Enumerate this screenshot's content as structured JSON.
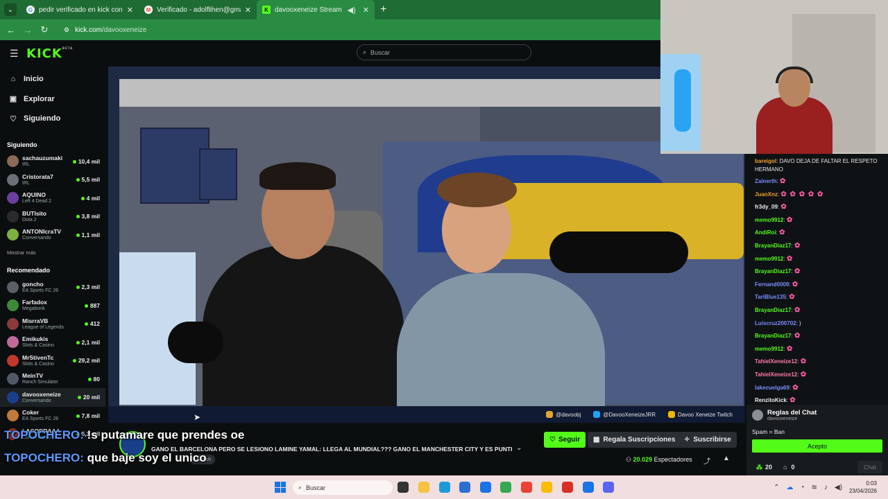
{
  "browser": {
    "tabs": [
      {
        "title": "pedir verificado en kick con you",
        "active": false
      },
      {
        "title": "Verificado - adolflihen@gmail.c",
        "active": false
      },
      {
        "title": "davooxeneize Stream - Wat",
        "active": true
      }
    ],
    "url_host": "kick.com",
    "url_path": "/davooxeneize",
    "colors": {
      "frame": "#1f6b34",
      "active_tab": "#2a8c43"
    }
  },
  "kick": {
    "logo": "KICK",
    "logo_badge": "BETA",
    "search_placeholder": "Buscar",
    "nav": [
      {
        "label": "Inicio",
        "icon": "home-icon",
        "glyph": "⌂"
      },
      {
        "label": "Explorar",
        "icon": "compass-icon",
        "glyph": "▣"
      },
      {
        "label": "Siguiendo",
        "icon": "heart-icon",
        "glyph": "♡"
      }
    ],
    "following_heading": "Siguiendo",
    "following": [
      {
        "name": "sachauzumaki",
        "category": "IRL",
        "viewers": "10,4 mil",
        "color": "#8a6a58"
      },
      {
        "name": "Cristorata7",
        "category": "IRL",
        "viewers": "5,5 mil",
        "color": "#6d6f78"
      },
      {
        "name": "AQUINO",
        "category": "Left 4 Dead 2",
        "viewers": "4 mil",
        "color": "#6b3fa0"
      },
      {
        "name": "BUTIsito",
        "category": "Dota 2",
        "viewers": "3,8 mil",
        "color": "#2b2b2b"
      },
      {
        "name": "ANTONIcraTV",
        "category": "Conversando",
        "viewers": "1,1 mil",
        "color": "#7fb043"
      }
    ],
    "show_more": "Mostrar más",
    "recommended_heading": "Recomendado",
    "recommended": [
      {
        "name": "goncho",
        "category": "EA Sports FC 26",
        "viewers": "2,3 mil",
        "color": "#5a5f68"
      },
      {
        "name": "Farfadox",
        "category": "Megabonk",
        "viewers": "887",
        "color": "#3e8a3a"
      },
      {
        "name": "MisrraVB",
        "category": "League of Legends",
        "viewers": "412",
        "color": "#8a3a3a"
      },
      {
        "name": "Emikukis",
        "category": "Slots & Casino",
        "viewers": "2,1 mil",
        "color": "#c06a9a"
      },
      {
        "name": "MrStivenTc",
        "category": "Slots & Casino",
        "viewers": "29,2 mil",
        "color": "#c0392b"
      },
      {
        "name": "MeinTV",
        "category": "Ranch Simulator",
        "viewers": "80",
        "color": "#4f5a66"
      },
      {
        "name": "davooxeneize",
        "category": "Conversando",
        "viewers": "20 mil",
        "color": "#1a3f8a",
        "active": true
      },
      {
        "name": "Coker",
        "category": "EA Sports FC 26",
        "viewers": "7,8 mil",
        "color": "#c07a3a"
      },
      {
        "name": "LACOBRAAA",
        "category": "Conversando",
        "viewers": "5,3 mil",
        "color": "#9a3030"
      }
    ],
    "accent": "#53fc18"
  },
  "video": {
    "overlay_socials": [
      {
        "icon": "instagram-icon",
        "text": "@davoobj",
        "color": "#e1a530"
      },
      {
        "icon": "twitter-icon",
        "text": "@DavooXeneizeJRR",
        "color": "#1da1f2"
      },
      {
        "icon": "youtube-icon",
        "text": "Davoo Xeneize Twitch",
        "color": "#f2b705"
      }
    ]
  },
  "stream_info": {
    "title": "GANO EL BARCELONA PERO SE LESIONO LAMINE YAMAL: LLEGA AL MUNDIAL??? GANO EL MANCHESTER CITY Y ES PUNTE...",
    "tag": "spanish",
    "follow_label": "Seguir",
    "gift_label": "Regala Suscripciones",
    "subscribe_label": "Suscribirse",
    "viewers_count": "20.029",
    "viewers_label": "Espectadores"
  },
  "captions": [
    {
      "user": "TOPOCHERO:",
      "text": " !s putamare que prendes oe"
    },
    {
      "user": "TOPOCHERO:",
      "text": " que baje soy el unico"
    }
  ],
  "chat": {
    "messages": [
      {
        "user": "bareigol",
        "color": "#f0a030",
        "text": ": DAVO DEJA DE FALTAR EL RESPETO HERMANO",
        "emotes": ""
      },
      {
        "user": "Zainerth",
        "color": "#7a8cff",
        "text": ":",
        "emotes": "✿"
      },
      {
        "user": "JuanXnz",
        "color": "#f0a030",
        "text": ":",
        "emotes": "✿ ✿ ✿ ✿ ✿"
      },
      {
        "user": "fr3dy_09",
        "color": "#eeeeee",
        "text": ":",
        "emotes": "✿"
      },
      {
        "user": "memo9912",
        "color": "#53fc18",
        "text": ":",
        "emotes": "✿"
      },
      {
        "user": "AndiRoi",
        "color": "#53fc18",
        "text": ":",
        "emotes": "✿"
      },
      {
        "user": "BrayanDiaz17",
        "color": "#53fc18",
        "text": ":",
        "emotes": "✿"
      },
      {
        "user": "memo9912",
        "color": "#53fc18",
        "text": ":",
        "emotes": "✿"
      },
      {
        "user": "BrayanDiaz17",
        "color": "#53fc18",
        "text": ":",
        "emotes": "✿"
      },
      {
        "user": "Fernand0009",
        "color": "#7a8cff",
        "text": ":",
        "emotes": "✿"
      },
      {
        "user": "TariBlue135",
        "color": "#7a8cff",
        "text": ":",
        "emotes": "✿"
      },
      {
        "user": "BrayanDiaz17",
        "color": "#53fc18",
        "text": ":",
        "emotes": "✿"
      },
      {
        "user": "Luiscruz200702",
        "color": "#7a8cff",
        "text": ": )",
        "emotes": ""
      },
      {
        "user": "BrayanDiaz17",
        "color": "#53fc18",
        "text": ":",
        "emotes": "✿"
      },
      {
        "user": "memo9912",
        "color": "#53fc18",
        "text": ":",
        "emotes": "✿"
      },
      {
        "user": "TahielXeneize12",
        "color": "#ff7aa8",
        "text": ":",
        "emotes": "✿"
      },
      {
        "user": "TahielXeneize12",
        "color": "#ff7aa8",
        "text": ":",
        "emotes": "✿"
      },
      {
        "user": "lakecuelga69",
        "color": "#7a8cff",
        "text": ":",
        "emotes": "✿"
      },
      {
        "user": "RenzitoKick",
        "color": "#eeeeee",
        "text": ":",
        "emotes": "✿"
      }
    ],
    "rules_title": "Reglas del Chat",
    "rules_channel": "davooxeneize",
    "rules_text": "Spam = Ban",
    "accept_label": "Acepto",
    "points": "20",
    "gifts": "0",
    "chat_button": "Chat"
  },
  "taskbar": {
    "search_placeholder": "Buscar",
    "time": "0:03",
    "date": "23/04/2026",
    "apps": [
      {
        "icon": "task-view-icon",
        "color": "#333333"
      },
      {
        "icon": "file-explorer-icon",
        "color": "#f5c242"
      },
      {
        "icon": "edge-icon",
        "color": "#1e9bd7"
      },
      {
        "icon": "store-icon",
        "color": "#2a6fd6"
      },
      {
        "icon": "outlook-icon",
        "color": "#1a73e8"
      },
      {
        "icon": "chrome-icon",
        "color": "#34a853"
      },
      {
        "icon": "chrome-profile-icon",
        "color": "#ea4335"
      },
      {
        "icon": "chrome-alt-icon",
        "color": "#fbbc05"
      },
      {
        "icon": "app-red-icon",
        "color": "#d93025"
      },
      {
        "icon": "chrome-active-icon",
        "color": "#1a73e8"
      },
      {
        "icon": "discord-icon",
        "color": "#5865f2"
      }
    ]
  }
}
